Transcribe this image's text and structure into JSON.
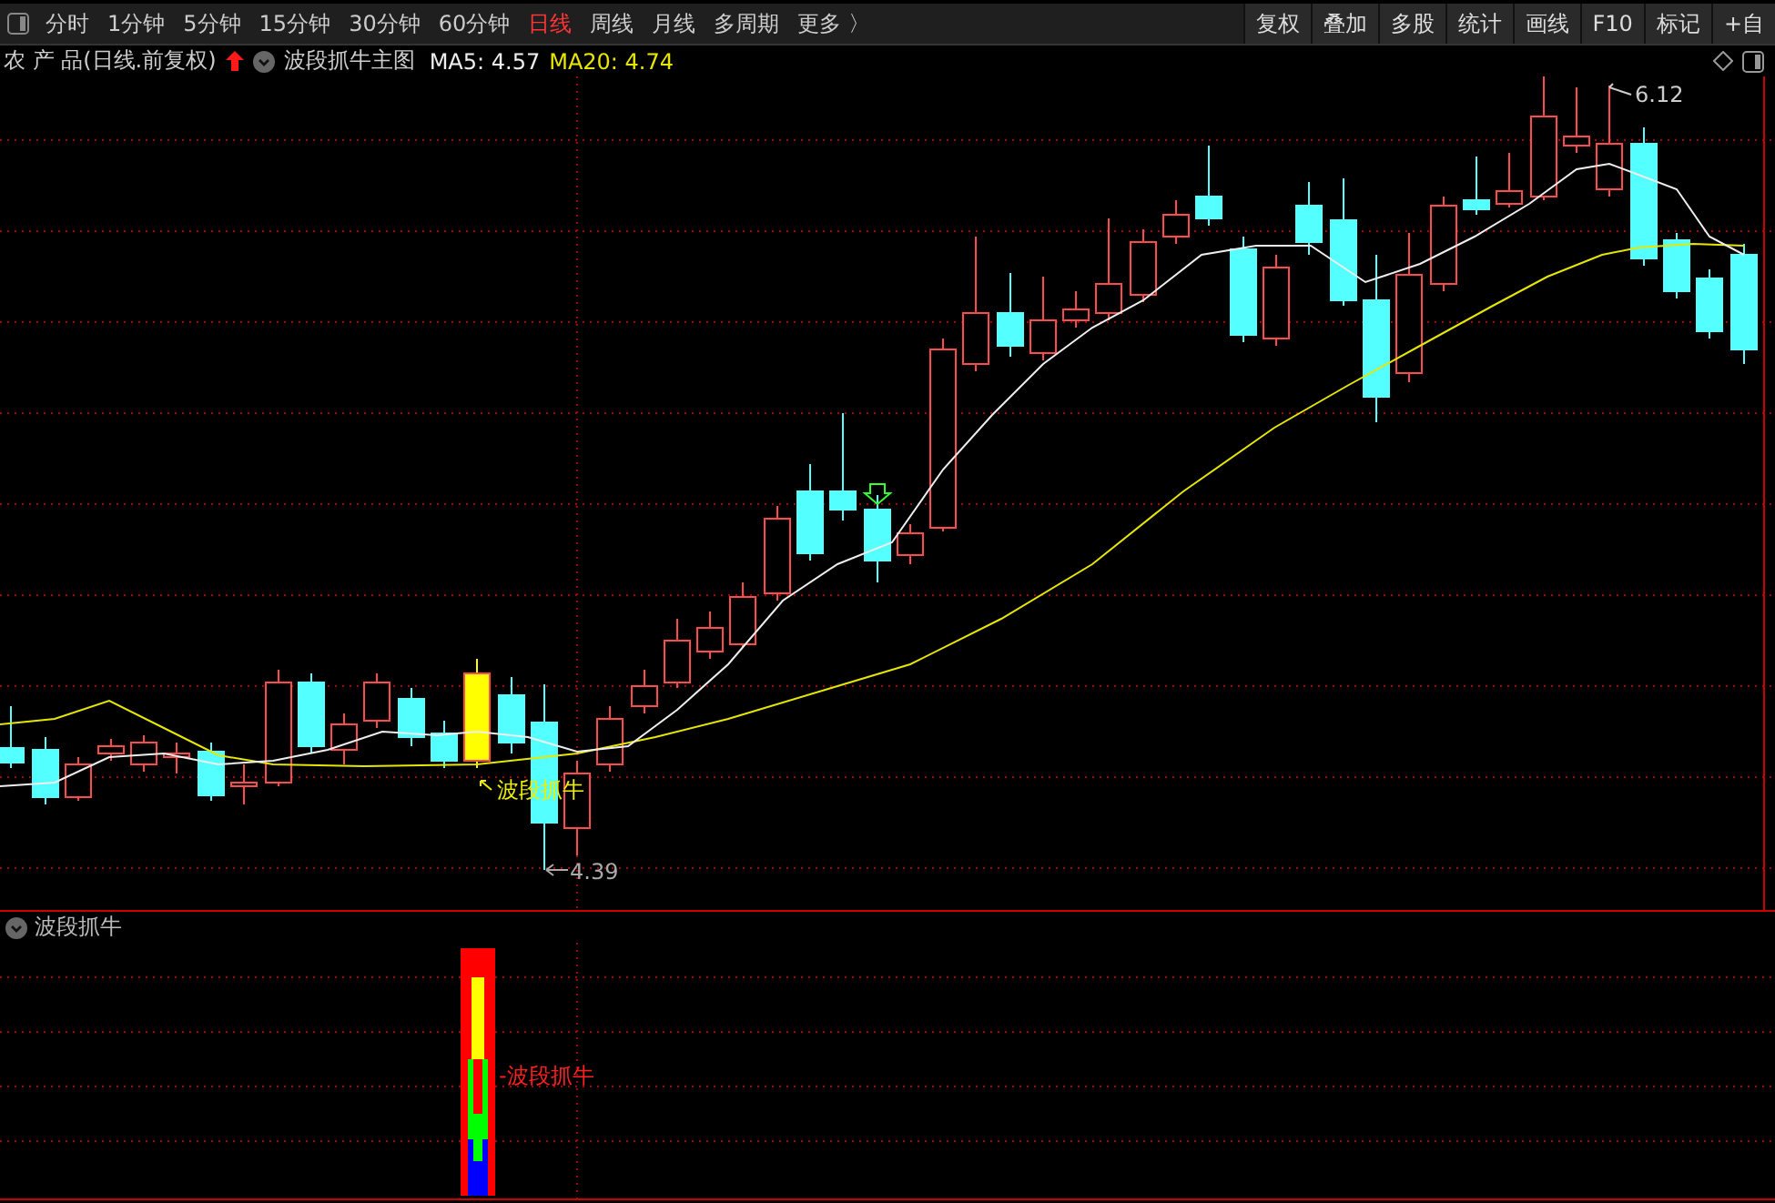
{
  "toolbar": {
    "periods": [
      {
        "label": "分时",
        "selected": false
      },
      {
        "label": "1分钟",
        "selected": false
      },
      {
        "label": "5分钟",
        "selected": false
      },
      {
        "label": "15分钟",
        "selected": false
      },
      {
        "label": "30分钟",
        "selected": false
      },
      {
        "label": "60分钟",
        "selected": false
      },
      {
        "label": "日线",
        "selected": true
      },
      {
        "label": "周线",
        "selected": false
      },
      {
        "label": "月线",
        "selected": false
      },
      {
        "label": "多周期",
        "selected": false
      },
      {
        "label": "更多 〉",
        "selected": false
      }
    ],
    "buttons": [
      "复权",
      "叠加",
      "多股",
      "统计",
      "画线",
      "F10",
      "标记",
      "+自"
    ]
  },
  "main_chart": {
    "stock": "农 产 品(日线.前复权)",
    "indicator": "波段抓牛主图",
    "ma5": "MA5: 4.57",
    "ma20": "MA20: 4.74",
    "high_label": "6.12",
    "low_label": "4.39",
    "signal_label": "波段抓牛"
  },
  "sub_panel": {
    "title": "波段抓牛",
    "signal_label": "-波段抓牛"
  }
}
